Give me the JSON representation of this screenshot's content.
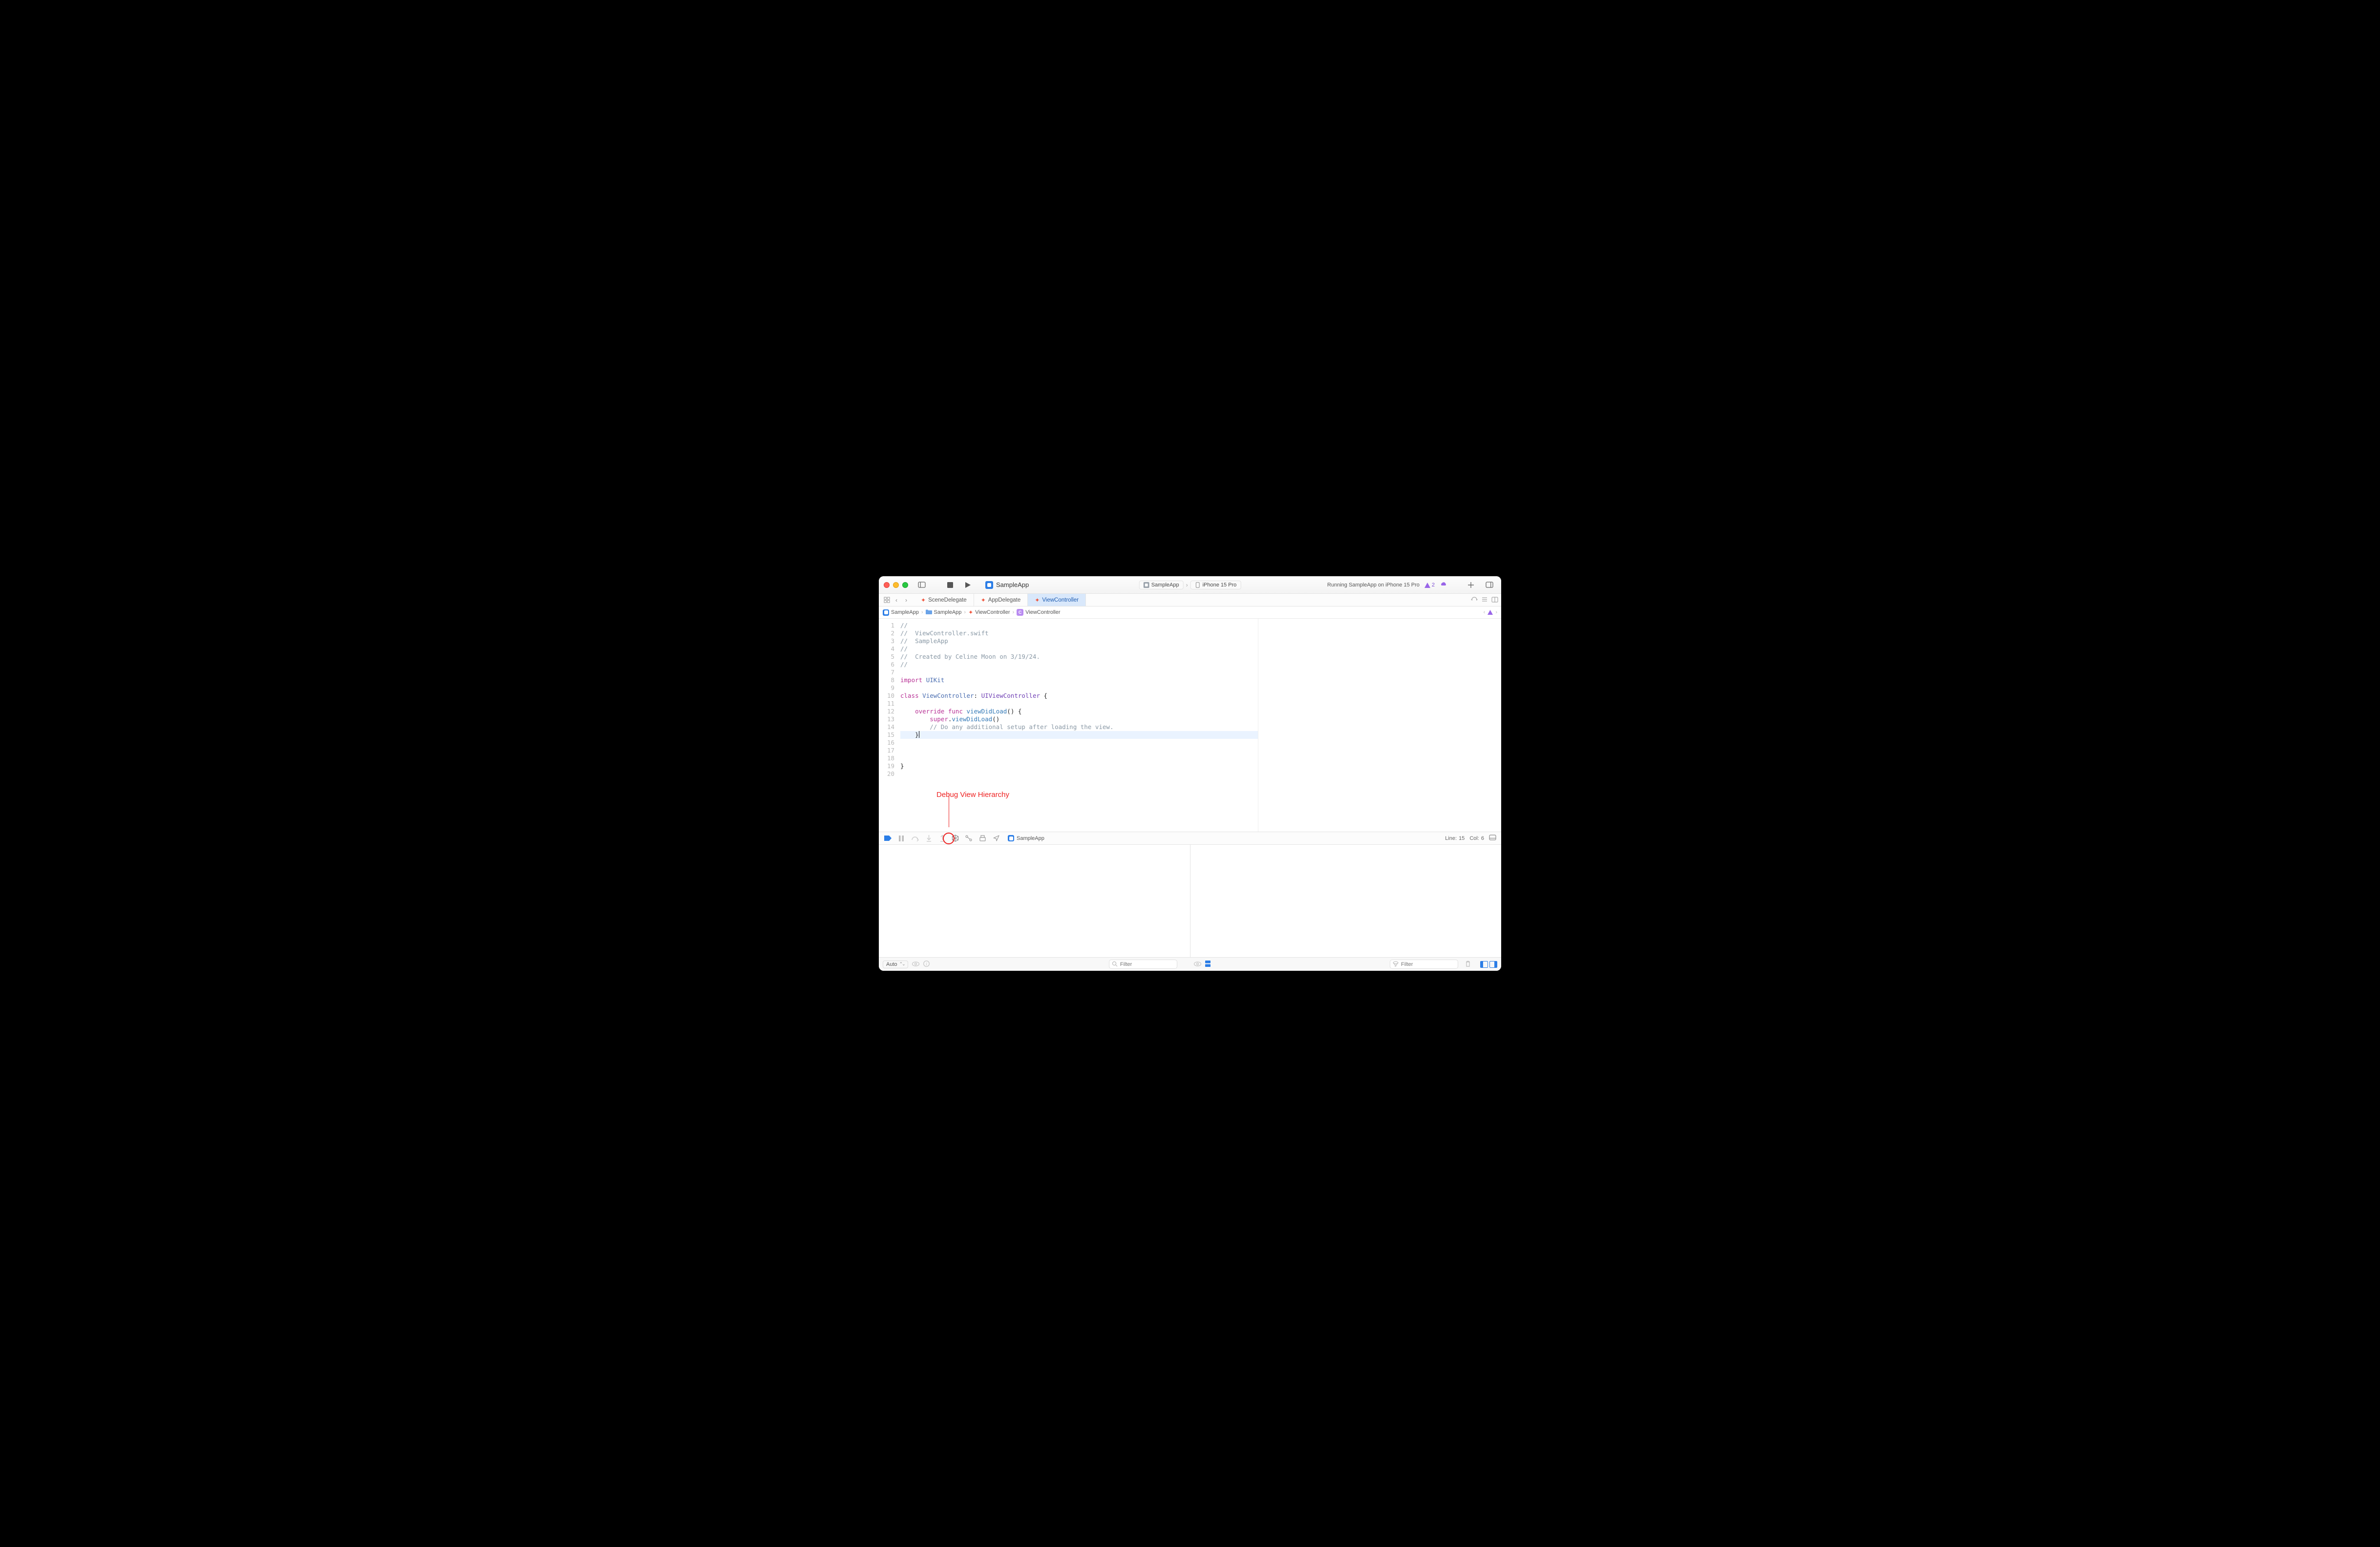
{
  "window": {
    "app_title": "SampleApp"
  },
  "scheme": {
    "target": "SampleApp",
    "device": "iPhone 15 Pro"
  },
  "status": {
    "text": "Running SampleApp on iPhone 15 Pro",
    "warnings": "2"
  },
  "tabs": [
    {
      "label": "SceneDelegate",
      "active": false
    },
    {
      "label": "AppDelegate",
      "active": false
    },
    {
      "label": "ViewController",
      "active": true
    }
  ],
  "breadcrumb": {
    "proj": "SampleApp",
    "folder": "SampleApp",
    "file": "ViewController",
    "symbol": "ViewController"
  },
  "code": {
    "lines": [
      "//",
      "//  ViewController.swift",
      "//  SampleApp",
      "//",
      "//  Created by Celine Moon on 3/19/24.",
      "//",
      "",
      "import UIKit",
      "",
      "class ViewController: UIViewController {",
      "",
      "    override func viewDidLoad() {",
      "        super.viewDidLoad()",
      "        // Do any additional setup after loading the view.",
      "    }",
      "",
      "",
      "}",
      "",
      ""
    ],
    "highlight_line": 15
  },
  "debugbar": {
    "scheme": "SampleApp"
  },
  "cursor": {
    "line": "15",
    "col": "6",
    "label_line": "Line:",
    "label_col": "Col:"
  },
  "footer": {
    "auto_label": "Auto",
    "filter_placeholder": "Filter"
  },
  "annotation": {
    "text": "Debug View Hierarchy"
  }
}
